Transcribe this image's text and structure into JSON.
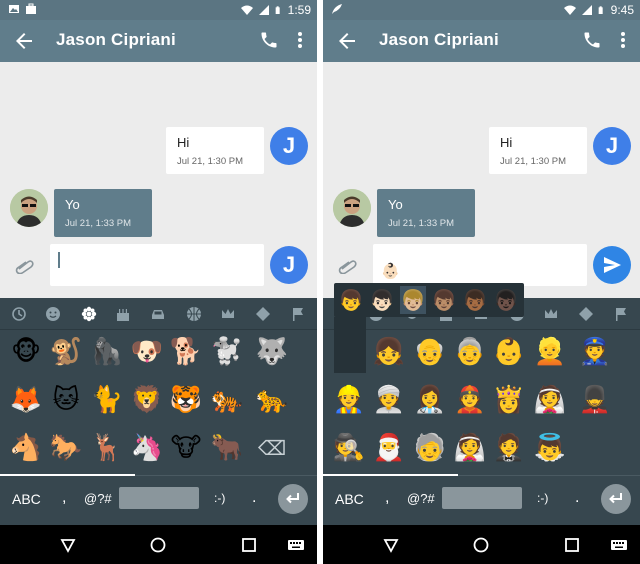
{
  "left": {
    "status": {
      "time": "1:59"
    },
    "toolbar": {
      "title": "Jason Cipriani"
    },
    "messages": [
      {
        "text": "Hi",
        "timestamp": "Jul 21, 1:30 PM",
        "direction": "out"
      },
      {
        "text": "Yo",
        "timestamp": "Jul 21, 1:33 PM",
        "direction": "in"
      }
    ],
    "avatar_letter": "J",
    "send_avatar_letter": "J",
    "emoji_tabs": [
      "recent-icon",
      "smiley-icon",
      "flower-icon",
      "cake-icon",
      "car-icon",
      "ball-icon",
      "crown-icon",
      "diamond-icon",
      "flag-icon"
    ],
    "emoji_rows": [
      [
        "🐵",
        "🐒",
        "🦍",
        "🐶",
        "🐕",
        "🐩",
        "🐺"
      ],
      [
        "🦊",
        "🐱",
        "🐈",
        "🦁",
        "🐯",
        "🐅",
        "🐆"
      ],
      [
        "🐴",
        "🐎",
        "🦌",
        "🦄",
        "🐮",
        "🐂",
        "⌫"
      ]
    ],
    "keyboard": {
      "abc": "ABC",
      "comma": ",",
      "symbols": "@?#",
      "smiley": ":-)",
      "period": "."
    }
  },
  "right": {
    "status": {
      "time": "9:45"
    },
    "toolbar": {
      "title": "Jason Cipriani"
    },
    "messages": [
      {
        "text": "Hi",
        "timestamp": "Jul 21, 1:30 PM",
        "direction": "out"
      },
      {
        "text": "Yo",
        "timestamp": "Jul 21, 1:33 PM",
        "direction": "in"
      }
    ],
    "avatar_letter": "J",
    "compose_emoji": "👶🏻",
    "popup_skin_tones": [
      "👦",
      "👦🏻",
      "👦🏼",
      "👦🏽",
      "👦🏾",
      "👦🏿"
    ],
    "emoji_rows": [
      [
        "👦",
        "👧",
        "👴",
        "👵",
        "👶",
        "👱",
        "👮"
      ],
      [
        "👷",
        "👳",
        "👩‍⚕️",
        "👲",
        "👸",
        "👰",
        "💂"
      ],
      [
        "🕵",
        "🎅",
        "🧓",
        "👰",
        "🤵",
        "👼"
      ]
    ],
    "keyboard": {
      "abc": "ABC",
      "comma": ",",
      "symbols": "@?#",
      "smiley": ":-)",
      "period": "."
    }
  },
  "colors": {
    "toolbar": "#607d8b",
    "statusbar": "#5b7582",
    "keyboard": "#37474f",
    "accent_blue": "#3f7fe8"
  }
}
